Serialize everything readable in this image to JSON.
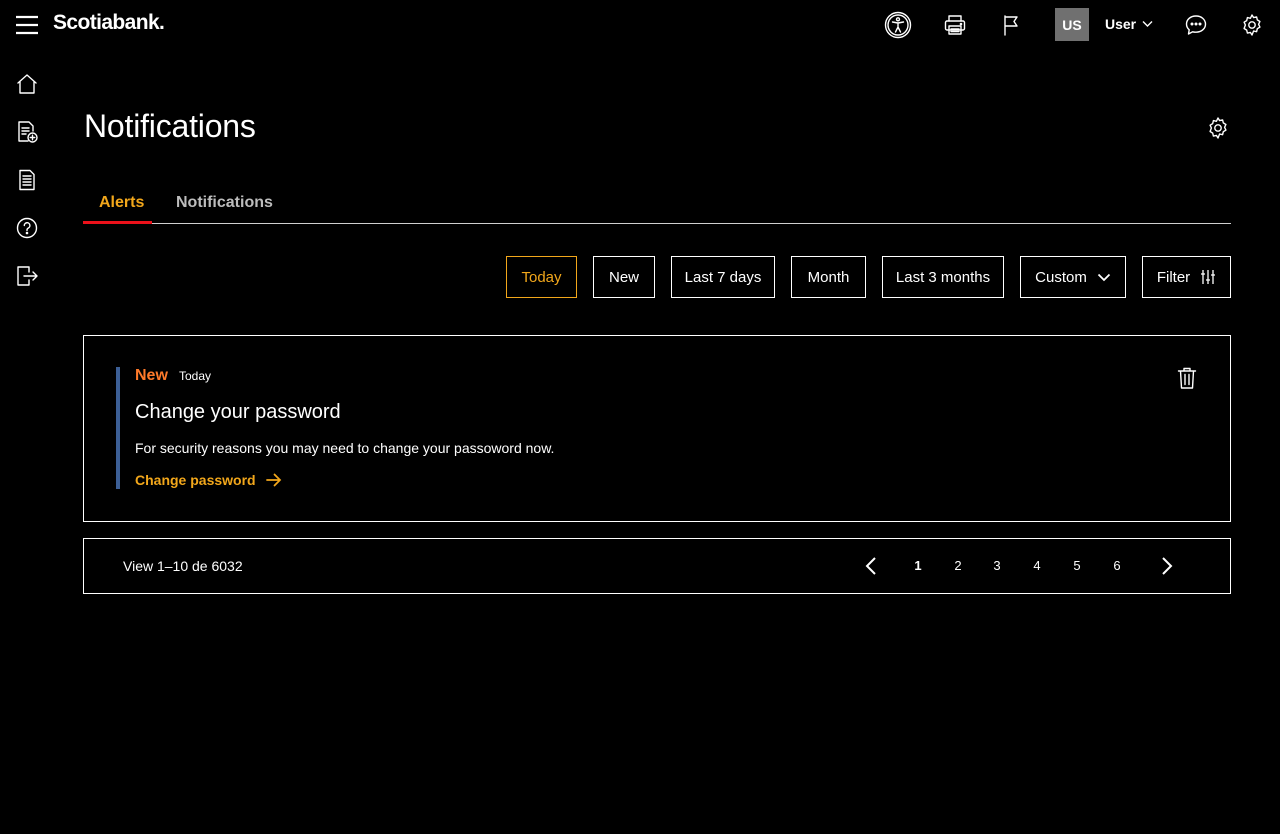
{
  "brand": {
    "name": "Scotiabank",
    "accent": "#ec111a",
    "highlight": "#f2a71b"
  },
  "topbar": {
    "icons": [
      "menu-icon",
      "accessibility-icon",
      "print-icon",
      "flag-icon",
      "chat-icon",
      "gear-icon"
    ],
    "avatar_initials": "US",
    "user_label": "User"
  },
  "sidebar": {
    "items": [
      {
        "icon": "home-icon"
      },
      {
        "icon": "add-document-icon"
      },
      {
        "icon": "document-icon"
      },
      {
        "icon": "help-icon"
      },
      {
        "icon": "logout-icon"
      }
    ]
  },
  "page": {
    "title": "Notifications"
  },
  "tabs": [
    {
      "label": "Alerts",
      "active": true
    },
    {
      "label": "Notifications",
      "active": false
    }
  ],
  "filters": {
    "options": [
      "Today",
      "New",
      "Last 7 days",
      "Month",
      "Last 3 months"
    ],
    "selected": "Today",
    "custom_label": "Custom",
    "filter_label": "Filter"
  },
  "notification": {
    "badge": "New",
    "date": "Today",
    "title": "Change your password",
    "body": "For security reasons you may need to change your passoword now.",
    "link_label": "Change password"
  },
  "pagination": {
    "info": "View 1–10 de 6032",
    "pages": [
      "1",
      "2",
      "3",
      "4",
      "5",
      "6"
    ],
    "current": "1"
  }
}
